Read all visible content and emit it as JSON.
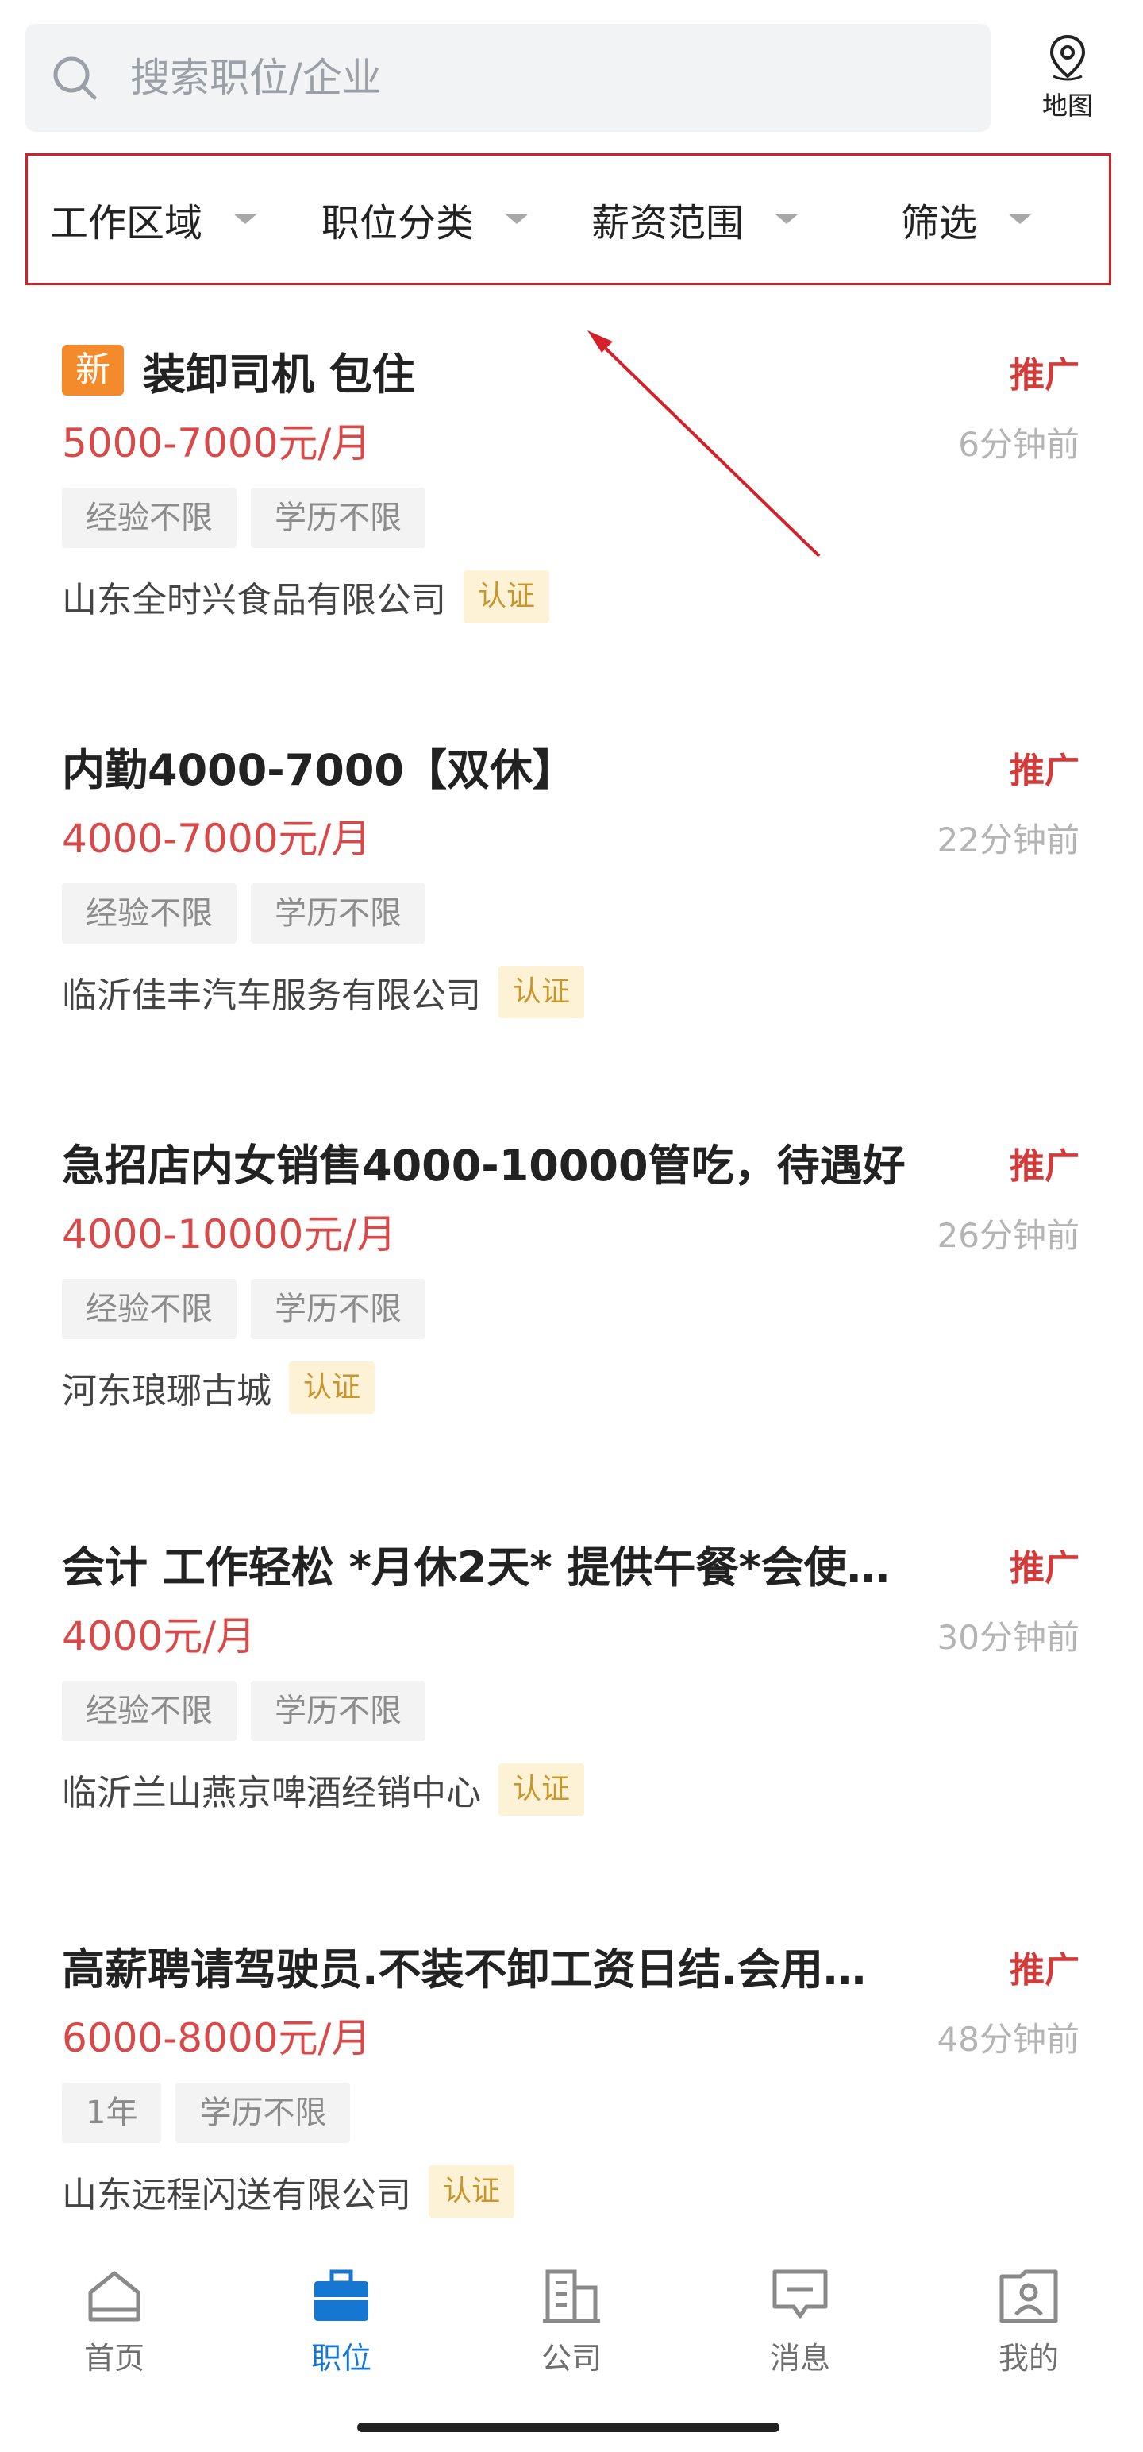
{
  "search": {
    "placeholder": "搜索职位/企业"
  },
  "map": {
    "label": "地图",
    "icon": "map-pin-icon"
  },
  "filters": [
    {
      "label": "工作区域"
    },
    {
      "label": "职位分类"
    },
    {
      "label": "薪资范围"
    },
    {
      "label": "筛选"
    }
  ],
  "jobs": [
    {
      "badge": "新",
      "title": "装卸司机  包住",
      "promo": "推广",
      "salary": "5000-7000元/月",
      "time": "6分钟前",
      "tags": [
        "经验不限",
        "学历不限"
      ],
      "company": "山东全时兴食品有限公司",
      "verify": "认证"
    },
    {
      "title": "内勤4000-7000【双休】",
      "promo": "推广",
      "salary": "4000-7000元/月",
      "time": "22分钟前",
      "tags": [
        "经验不限",
        "学历不限"
      ],
      "company": "临沂佳丰汽车服务有限公司",
      "verify": "认证"
    },
    {
      "title": "急招店内女销售4000-10000管吃，待遇好",
      "promo": "推广",
      "salary": "4000-10000元/月",
      "time": "26分钟前",
      "tags": [
        "经验不限",
        "学历不限"
      ],
      "company": "河东琅琊古城",
      "verify": "认证"
    },
    {
      "title": "会计 工作轻松 *月休2天* 提供午餐*会使…",
      "promo": "推广",
      "salary": "4000元/月",
      "time": "30分钟前",
      "tags": [
        "经验不限",
        "学历不限"
      ],
      "company": "临沂兰山燕京啤酒经销中心",
      "verify": "认证"
    },
    {
      "title": "高薪聘请驾驶员.不装不卸工资日结.会用…",
      "promo": "推广",
      "salary": "6000-8000元/月",
      "time": "48分钟前",
      "tags": [
        "1年",
        "学历不限"
      ],
      "company": "山东远程闪送有限公司",
      "verify": "认证"
    }
  ],
  "tabs": [
    {
      "label": "首页",
      "icon": "home-icon",
      "active": false
    },
    {
      "label": "职位",
      "icon": "briefcase-icon",
      "active": true
    },
    {
      "label": "公司",
      "icon": "building-icon",
      "active": false
    },
    {
      "label": "消息",
      "icon": "message-icon",
      "active": false
    },
    {
      "label": "我的",
      "icon": "profile-icon",
      "active": false
    }
  ],
  "colors": {
    "accent": "#1677d2",
    "salary": "#d84a4a",
    "promo": "#d33a3a",
    "highlight_box": "#d32029",
    "new_badge": "#f38a2c"
  }
}
